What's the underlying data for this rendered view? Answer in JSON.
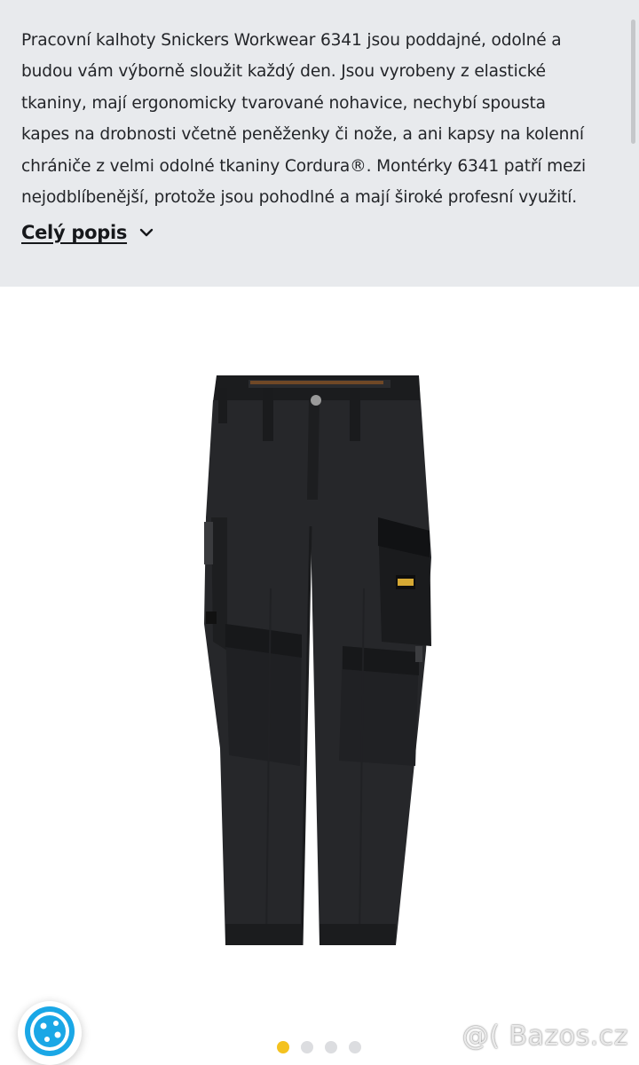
{
  "description": {
    "lines": [
      "Pracovní kalhoty Snickers Workwear 6341 jsou poddajné, odolné a",
      "budou vám výborně sloužit každý den. Jsou vyrobeny z elastické",
      "tkaniny, mají ergonomicky tvarované nohavice, nechybí spousta",
      "kapes na drobnosti včetně peněženky či nože, a ani kapsy na kolenní",
      "chrániče z velmi odolné tkaniny Cordura®. Montérky 6341 patří mezi",
      "nejodblíbenější, protože jsou pohodlné a mají široké profesní využití."
    ],
    "more_label": "Celý popis"
  },
  "gallery": {
    "image_name": "snickers-6341-work-trousers",
    "slide_count": 4,
    "active_slide": 1
  },
  "watermark": "@( Bazos.cz",
  "colors": {
    "panel_bg": "#e8eaed",
    "active_dot": "#f4c21f",
    "inactive_dot": "#dcdde0",
    "chat_icon": "#1aa7e6"
  }
}
